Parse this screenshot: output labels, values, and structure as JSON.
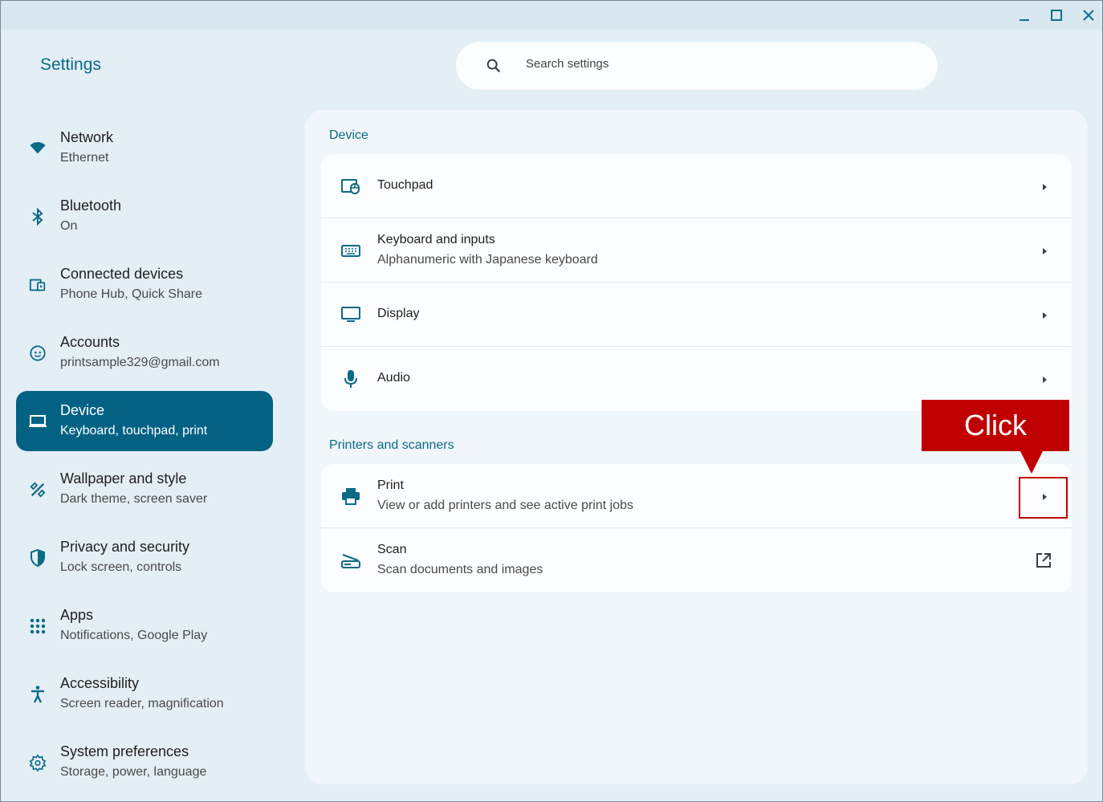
{
  "window": {
    "minimize_icon": "minimize-icon",
    "maximize_icon": "maximize-icon",
    "close_icon": "close-icon"
  },
  "app": {
    "title": "Settings"
  },
  "search": {
    "placeholder": "Search settings",
    "icon": "search-icon"
  },
  "sidebar": {
    "items": [
      {
        "title": "Network",
        "subtitle": "Ethernet",
        "icon": "wifi-icon"
      },
      {
        "title": "Bluetooth",
        "subtitle": "On",
        "icon": "bluetooth-icon"
      },
      {
        "title": "Connected devices",
        "subtitle": "Phone Hub, Quick Share",
        "icon": "connected-devices-icon"
      },
      {
        "title": "Accounts",
        "subtitle": "printsample329@gmail.com",
        "icon": "account-face-icon"
      },
      {
        "title": "Device",
        "subtitle": "Keyboard, touchpad, print",
        "icon": "laptop-icon",
        "active": true
      },
      {
        "title": "Wallpaper and style",
        "subtitle": "Dark theme, screen saver",
        "icon": "palette-icon"
      },
      {
        "title": "Privacy and security",
        "subtitle": "Lock screen, controls",
        "icon": "shield-icon"
      },
      {
        "title": "Apps",
        "subtitle": "Notifications, Google Play",
        "icon": "apps-grid-icon"
      },
      {
        "title": "Accessibility",
        "subtitle": "Screen reader, magnification",
        "icon": "accessibility-icon"
      },
      {
        "title": "System preferences",
        "subtitle": "Storage, power, language",
        "icon": "gear-icon"
      }
    ]
  },
  "main": {
    "device_section": {
      "label": "Device",
      "rows": [
        {
          "title": "Touchpad",
          "subtitle": "",
          "icon": "touchpad-icon",
          "action": "chevron-right-icon"
        },
        {
          "title": "Keyboard and inputs",
          "subtitle": "Alphanumeric with Japanese keyboard",
          "icon": "keyboard-icon",
          "action": "chevron-right-icon"
        },
        {
          "title": "Display",
          "subtitle": "",
          "icon": "monitor-icon",
          "action": "chevron-right-icon"
        },
        {
          "title": "Audio",
          "subtitle": "",
          "icon": "microphone-icon",
          "action": "chevron-right-icon"
        }
      ]
    },
    "printers_section": {
      "label": "Printers and scanners",
      "rows": [
        {
          "title": "Print",
          "subtitle": "View or add printers and see active print jobs",
          "icon": "printer-icon",
          "action": "chevron-right-icon"
        },
        {
          "title": "Scan",
          "subtitle": "Scan documents and images",
          "icon": "scanner-icon",
          "action": "external-link-icon"
        }
      ]
    }
  },
  "annotation": {
    "callout_text": "Click",
    "color": "#c00000"
  },
  "colors": {
    "accent": "#036283",
    "accent_text": "#0b6a86",
    "background": "#e3eef5"
  }
}
